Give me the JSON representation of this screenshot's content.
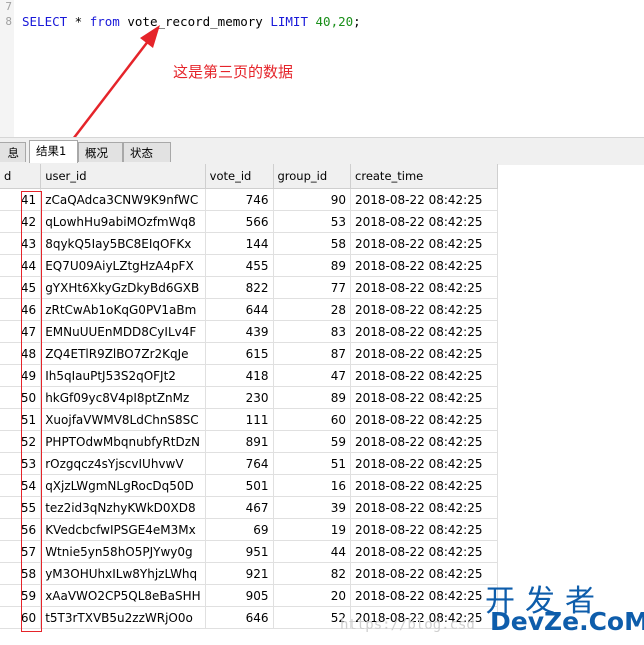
{
  "editor": {
    "line_numbers": [
      "7",
      "8"
    ],
    "sql": {
      "select": "SELECT",
      "star": " * ",
      "from": "from",
      "table": " vote_record_memory ",
      "limit": "LIMIT",
      "space": " ",
      "args": "40,20",
      "end": ";"
    },
    "annotation": "这是第三页的数据"
  },
  "tabs": [
    {
      "label": "息",
      "active": false
    },
    {
      "label": "结果1",
      "active": true
    },
    {
      "label": "概况",
      "active": false
    },
    {
      "label": "状态",
      "active": false
    }
  ],
  "grid": {
    "columns": [
      "d",
      "user_id",
      "vote_id",
      "group_id",
      "create_time"
    ],
    "rows": [
      [
        "41",
        "zCaQAdca3CNW9K9nfWC",
        "746",
        "90",
        "2018-08-22 08:42:25"
      ],
      [
        "42",
        "qLowhHu9abiMOzfmWq8",
        "566",
        "53",
        "2018-08-22 08:42:25"
      ],
      [
        "43",
        "8qykQ5Iay5BC8EIqOFKx",
        "144",
        "58",
        "2018-08-22 08:42:25"
      ],
      [
        "44",
        "EQ7U09AiyLZtgHzA4pFX",
        "455",
        "89",
        "2018-08-22 08:42:25"
      ],
      [
        "45",
        "gYXHt6XkyGzDkyBd6GXB",
        "822",
        "77",
        "2018-08-22 08:42:25"
      ],
      [
        "46",
        "zRtCwAb1oKqG0PV1aBm",
        "644",
        "28",
        "2018-08-22 08:42:25"
      ],
      [
        "47",
        "EMNuUUEnMDD8CyILv4F",
        "439",
        "83",
        "2018-08-22 08:42:25"
      ],
      [
        "48",
        "ZQ4ETlR9ZlBO7Zr2KqJe",
        "615",
        "87",
        "2018-08-22 08:42:25"
      ],
      [
        "49",
        "Ih5qIauPtJ53S2qOFJt2",
        "418",
        "47",
        "2018-08-22 08:42:25"
      ],
      [
        "50",
        "hkGf09yc8V4pI8ptZnMz",
        "230",
        "89",
        "2018-08-22 08:42:25"
      ],
      [
        "51",
        "XuojfaVWMV8LdChnS8SC",
        "111",
        "60",
        "2018-08-22 08:42:25"
      ],
      [
        "52",
        "PHPTOdwMbqnubfyRtDzN",
        "891",
        "59",
        "2018-08-22 08:42:25"
      ],
      [
        "53",
        "rOzgqcz4sYjscvIUhvwV",
        "764",
        "51",
        "2018-08-22 08:42:25"
      ],
      [
        "54",
        "qXjzLWgmNLgRocDq50D",
        "501",
        "16",
        "2018-08-22 08:42:25"
      ],
      [
        "55",
        "tez2id3qNzhyKWkD0XD8",
        "467",
        "39",
        "2018-08-22 08:42:25"
      ],
      [
        "56",
        "KVedcbcfwIPSGE4eM3Mx",
        "69",
        "19",
        "2018-08-22 08:42:25"
      ],
      [
        "57",
        "Wtnie5yn58hO5PJYwy0g",
        "951",
        "44",
        "2018-08-22 08:42:25"
      ],
      [
        "58",
        "yM3OHUhxILw8YhjzLWhq",
        "921",
        "82",
        "2018-08-22 08:42:25"
      ],
      [
        "59",
        "xAaVWO2CP5QL8eBaSHH",
        "905",
        "20",
        "2018-08-22 08:42:25"
      ],
      [
        "60",
        "t5T3rTXVB5u2zzWRjO0o",
        "646",
        "52",
        "2018-08-22 08:42:25"
      ]
    ]
  },
  "watermark": {
    "url": "https://blog.csd",
    "cn": "开发者",
    "en": "DevZe.CoM"
  },
  "colors": {
    "keyword": "#1919d9",
    "number": "#1a8f1a",
    "annotation_red": "#e5242a",
    "watermark_blue": "#0e5dab"
  }
}
